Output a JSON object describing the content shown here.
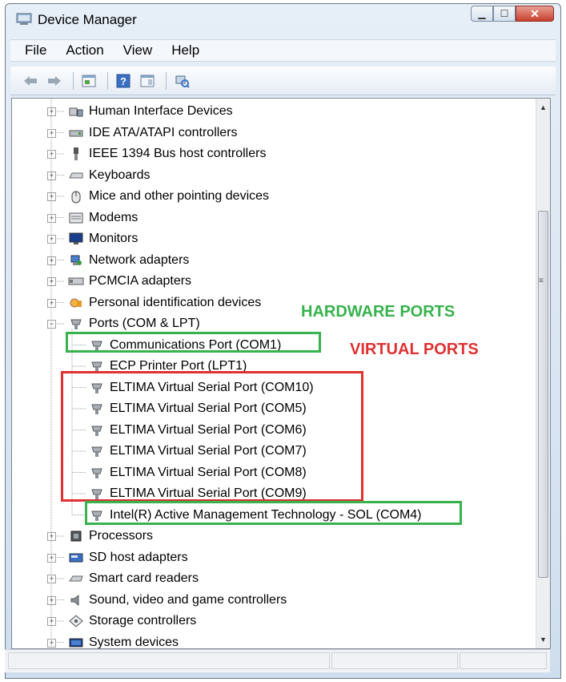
{
  "window": {
    "title": "Device Manager"
  },
  "menu": [
    "File",
    "Action",
    "View",
    "Help"
  ],
  "toolbar": [
    "back-icon",
    "forward-icon",
    "properties-icon",
    "help-icon",
    "show-hide-icon",
    "scan-hardware-icon"
  ],
  "tree": [
    {
      "label": "Human Interface Devices",
      "icon": "hid-icon",
      "level": 1,
      "expander": "+"
    },
    {
      "label": "IDE ATA/ATAPI controllers",
      "icon": "ide-icon",
      "level": 1,
      "expander": "+"
    },
    {
      "label": "IEEE 1394 Bus host controllers",
      "icon": "ieee1394-icon",
      "level": 1,
      "expander": "+"
    },
    {
      "label": "Keyboards",
      "icon": "keyboard-icon",
      "level": 1,
      "expander": "+"
    },
    {
      "label": "Mice and other pointing devices",
      "icon": "mouse-icon",
      "level": 1,
      "expander": "+"
    },
    {
      "label": "Modems",
      "icon": "modem-icon",
      "level": 1,
      "expander": "+"
    },
    {
      "label": "Monitors",
      "icon": "monitor-icon",
      "level": 1,
      "expander": "+"
    },
    {
      "label": "Network adapters",
      "icon": "network-icon",
      "level": 1,
      "expander": "+"
    },
    {
      "label": "PCMCIA adapters",
      "icon": "pcmcia-icon",
      "level": 1,
      "expander": "+"
    },
    {
      "label": "Personal identification devices",
      "icon": "id-device-icon",
      "level": 1,
      "expander": "+"
    },
    {
      "label": "Ports (COM & LPT)",
      "icon": "port-icon",
      "level": 1,
      "expander": "-"
    },
    {
      "label": "Communications Port (COM1)",
      "icon": "port-icon",
      "level": 2
    },
    {
      "label": "ECP Printer Port (LPT1)",
      "icon": "port-icon",
      "level": 2
    },
    {
      "label": "ELTIMA Virtual Serial Port (COM10)",
      "icon": "port-icon",
      "level": 2
    },
    {
      "label": "ELTIMA Virtual Serial Port (COM5)",
      "icon": "port-icon",
      "level": 2
    },
    {
      "label": "ELTIMA Virtual Serial Port (COM6)",
      "icon": "port-icon",
      "level": 2
    },
    {
      "label": "ELTIMA Virtual Serial Port (COM7)",
      "icon": "port-icon",
      "level": 2
    },
    {
      "label": "ELTIMA Virtual Serial Port (COM8)",
      "icon": "port-icon",
      "level": 2
    },
    {
      "label": "ELTIMA Virtual Serial Port (COM9)",
      "icon": "port-icon",
      "level": 2
    },
    {
      "label": "Intel(R) Active Management Technology - SOL (COM4)",
      "icon": "port-icon",
      "level": 2
    },
    {
      "label": "Processors",
      "icon": "processor-icon",
      "level": 1,
      "expander": "+"
    },
    {
      "label": "SD host adapters",
      "icon": "sd-icon",
      "level": 1,
      "expander": "+"
    },
    {
      "label": "Smart card readers",
      "icon": "smartcard-icon",
      "level": 1,
      "expander": "+"
    },
    {
      "label": "Sound, video and game controllers",
      "icon": "sound-icon",
      "level": 1,
      "expander": "+"
    },
    {
      "label": "Storage controllers",
      "icon": "storage-icon",
      "level": 1,
      "expander": "+"
    },
    {
      "label": "System devices",
      "icon": "system-icon",
      "level": 1,
      "expander": "+"
    }
  ],
  "annotations": {
    "hardware_label": "HARDWARE PORTS",
    "virtual_label": "VIRTUAL PORTS",
    "hardware_color": "#37b24d",
    "virtual_color": "#e03131"
  }
}
